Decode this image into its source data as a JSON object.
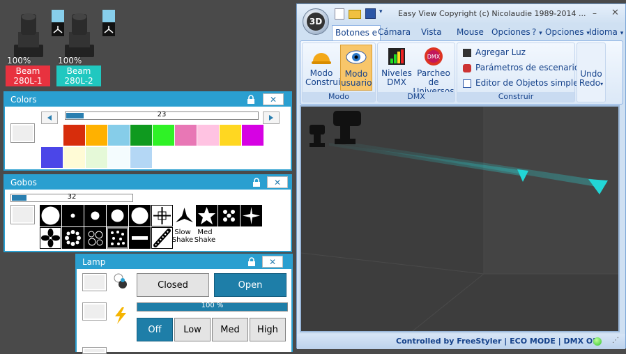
{
  "fixtures": [
    {
      "pct": "100%",
      "line1": "Beam",
      "line2": "280L-1",
      "color": "#e8323f"
    },
    {
      "pct": "100%",
      "line1": "Beam",
      "line2": "280L-2",
      "color": "#20c8c0"
    }
  ],
  "colors_panel": {
    "title": "Colors",
    "slider_value": "23",
    "slider_fraction": 0.09,
    "palette": [
      "#d72d0c",
      "#ffb100",
      "#86cde9",
      "#0f9a1f",
      "#2ff226",
      "#e877b5",
      "#ffc3e2",
      "#ffd721",
      "#d602e3",
      "#4b46e8",
      "#fffbd6",
      "#e5f9d8",
      "#f4fcfe",
      "#b4d7f5"
    ]
  },
  "gobos_panel": {
    "title": "Gobos",
    "slider_value": "32",
    "slider_fraction": 0.12,
    "slow_shake": "Slow\nShake",
    "med_shake": "Med\nShake"
  },
  "lamp_panel": {
    "title": "Lamp",
    "closed_label": "Closed",
    "open_label": "Open",
    "dimmer_value": "100 %",
    "off_label": "Off",
    "low_label": "Low",
    "med_label": "Med",
    "high_label": "High"
  },
  "window": {
    "orb_label": "3D",
    "title": "Easy View   Copyright (c) Nicolaudie 1989-2014 ...",
    "tabs": [
      "Botones e",
      "Cámara",
      "Vista",
      "Mouse",
      "Opciones",
      "?",
      "Opciones",
      "Idioma"
    ],
    "ribbon": {
      "modo_construir": "Modo\nConstruir",
      "modo_usuario": "Modo\nusuario",
      "group_modo": "Modo",
      "niveles_dmx": "Niveles\nDMX",
      "parcheo": "Parcheo de\nUniversos",
      "group_dmx": "DMX",
      "agregar_luz": "Agregar Luz",
      "parametros": "Parámetros de escenario...",
      "editor": "Editor de Objetos simples",
      "group_construir": "Construir",
      "undo": "Undo",
      "redo": "Redo"
    },
    "status": "Controlled by FreeStyler  |  ECO MODE  |  DMX ON"
  }
}
